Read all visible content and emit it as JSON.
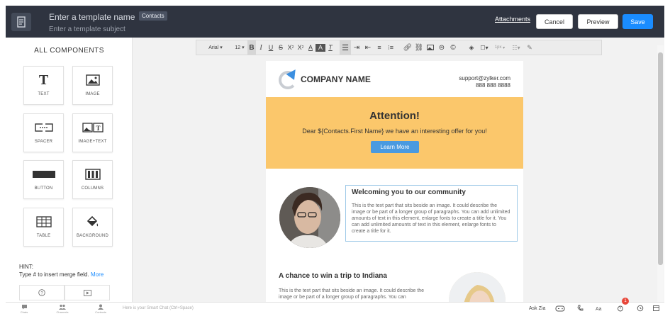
{
  "header": {
    "template_name_placeholder": "Enter a template name",
    "template_subject_placeholder": "Enter a template subject",
    "module_tag": "Contacts",
    "attachments_label": "Attachments",
    "cancel_label": "Cancel",
    "preview_label": "Preview",
    "save_label": "Save"
  },
  "sidebar": {
    "title": "ALL COMPONENTS",
    "components": [
      {
        "label": "TEXT",
        "icon": "text-icon"
      },
      {
        "label": "IMAGE",
        "icon": "image-icon"
      },
      {
        "label": "SPACER",
        "icon": "spacer-icon"
      },
      {
        "label": "IMAGE+TEXT",
        "icon": "image-text-icon"
      },
      {
        "label": "BUTTON",
        "icon": "button-icon"
      },
      {
        "label": "COLUMNS",
        "icon": "columns-icon"
      },
      {
        "label": "TABLE",
        "icon": "table-icon"
      },
      {
        "label": "BACKGROUND",
        "icon": "paint-bucket-icon"
      }
    ],
    "hint_title": "HINT:",
    "hint_text": "Type # to insert merge field.",
    "hint_more": "More"
  },
  "toolbar": {
    "font_family": "Arial",
    "font_size": "12",
    "line_height": "1px"
  },
  "email": {
    "company_name": "COMPANY NAME",
    "support_email": "support@zylker.com",
    "support_phone": "888 888 8888",
    "banner_title": "Attention!",
    "banner_text": "Dear ${Contacts.First Name} we have an interesting offer for you!",
    "banner_button": "Learn More",
    "section1_title": "Welcoming you to our community",
    "section1_text": "This is the text part that sits beside an image. It could describe the image or be part of a longer group of paragraphs. You can add unlimited amounts of text in this element, enlarge fonts to create a title for it. You can add unlimited amounts of text in this element, enlarge fonts to create a title for it.",
    "section2_title": "A chance to win a trip to Indiana",
    "section2_text": "This is the text part that sits beside an image. It could describe the image or be part of a longer group of paragraphs. You can"
  },
  "bottombar": {
    "items": [
      "Chats",
      "Channels",
      "Contacts"
    ],
    "smart_chat_placeholder": "Here is your Smart Chat (Ctrl+Space)",
    "ask_zia": "Ask Zia",
    "notification_count": "1"
  },
  "colors": {
    "header_bg": "#2f3440",
    "save_blue": "#1a8cff",
    "banner_yellow": "#fbc76b",
    "learn_more_blue": "#4a9ae0"
  }
}
